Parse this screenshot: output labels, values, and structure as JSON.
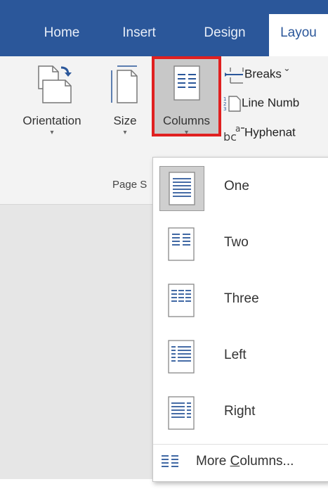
{
  "tabs": [
    "Home",
    "Insert",
    "Design",
    "Layou"
  ],
  "ribbon": {
    "orientation": "Orientation",
    "size": "Size",
    "columns": "Columns",
    "breaks": "Breaks ˇ",
    "line_numbers": "Line Numb",
    "hyphenation": "Hyphenat",
    "group_label": "Page S"
  },
  "columns_menu": {
    "items": [
      "One",
      "Two",
      "Three",
      "Left",
      "Right"
    ],
    "selected": "One",
    "more_prefix": "More ",
    "more_underlined": "C",
    "more_suffix": "olumns..."
  },
  "colors": {
    "tab_bar": "#2b579a",
    "highlight_border": "#e02020",
    "ribbon_bg": "#f3f3f3"
  }
}
